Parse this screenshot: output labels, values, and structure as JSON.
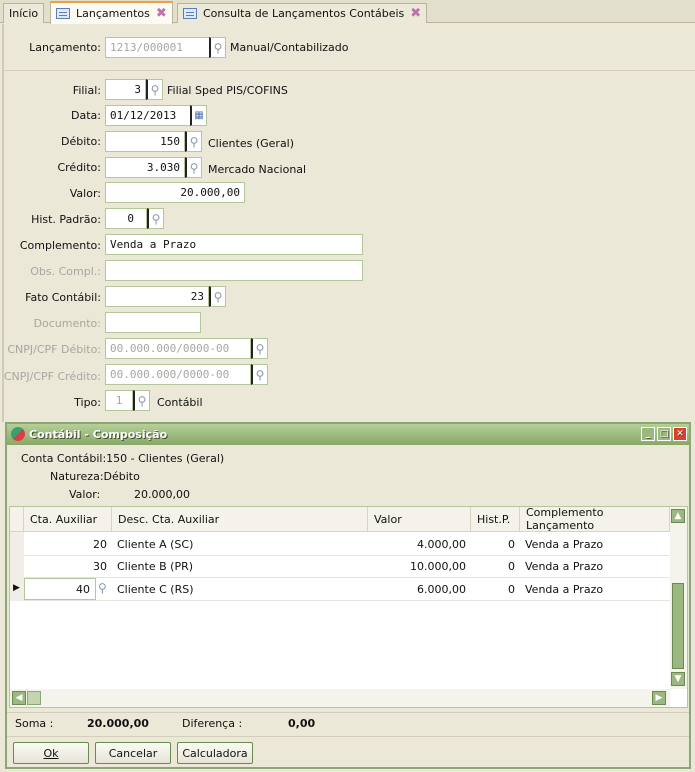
{
  "tabs": [
    {
      "label": "Início"
    },
    {
      "label": "Lançamentos"
    },
    {
      "label": "Consulta de Lançamentos Contábeis"
    }
  ],
  "form": {
    "lancamento": {
      "label": "Lançamento:",
      "value": "1213/000001",
      "desc": "Manual/Contabilizado"
    },
    "filial": {
      "label": "Filial:",
      "value": "3",
      "desc": "Filial Sped PIS/COFINS"
    },
    "data": {
      "label": "Data:",
      "value": "01/12/2013"
    },
    "debito": {
      "label": "Débito:",
      "value": "150",
      "desc": "Clientes (Geral)"
    },
    "credito": {
      "label": "Crédito:",
      "value": "3.030",
      "desc": "Mercado Nacional"
    },
    "valor": {
      "label": "Valor:",
      "value": "20.000,00"
    },
    "hist": {
      "label": "Hist. Padrão:",
      "value": "0"
    },
    "complemento": {
      "label": "Complemento:",
      "value": "Venda a Prazo"
    },
    "obs": {
      "label": "Obs. Compl.:",
      "value": ""
    },
    "fato": {
      "label": "Fato Contábil:",
      "value": "23"
    },
    "documento": {
      "label": "Documento:",
      "value": ""
    },
    "cnpj_deb": {
      "label": "CNPJ/CPF Débito:",
      "value": "00.000.000/0000-00"
    },
    "cnpj_cred": {
      "label": "CNPJ/CPF Crédito:",
      "value": "00.000.000/0000-00"
    },
    "tipo": {
      "label": "Tipo:",
      "value": "1",
      "desc": "Contábil"
    }
  },
  "dialog": {
    "title": "Contábil - Composição",
    "conta_label": "Conta Contábil:",
    "conta_value": "150 - Clientes (Geral)",
    "natureza_label": "Natureza:",
    "natureza_value": "Débito",
    "valor_label": "Valor:",
    "valor_value": "20.000,00",
    "columns": [
      "Cta. Auxiliar",
      "Desc. Cta. Auxiliar",
      "Valor",
      "Hist.P.",
      "Complemento Lançamento"
    ],
    "rows": [
      {
        "cta": "20",
        "desc": "Cliente A (SC)",
        "valor": "4.000,00",
        "hist": "0",
        "compl": "Venda a Prazo"
      },
      {
        "cta": "30",
        "desc": "Cliente B (PR)",
        "valor": "10.000,00",
        "hist": "0",
        "compl": "Venda a Prazo"
      },
      {
        "cta": "40",
        "desc": "Cliente C (RS)",
        "valor": "6.000,00",
        "hist": "0",
        "compl": "Venda a Prazo"
      }
    ],
    "soma_label": "Soma :",
    "soma_value": "20.000,00",
    "dif_label": "Diferença :",
    "dif_value": "0,00",
    "buttons": {
      "ok": "Ok",
      "cancelar": "Cancelar",
      "calculadora": "Calculadora"
    }
  }
}
